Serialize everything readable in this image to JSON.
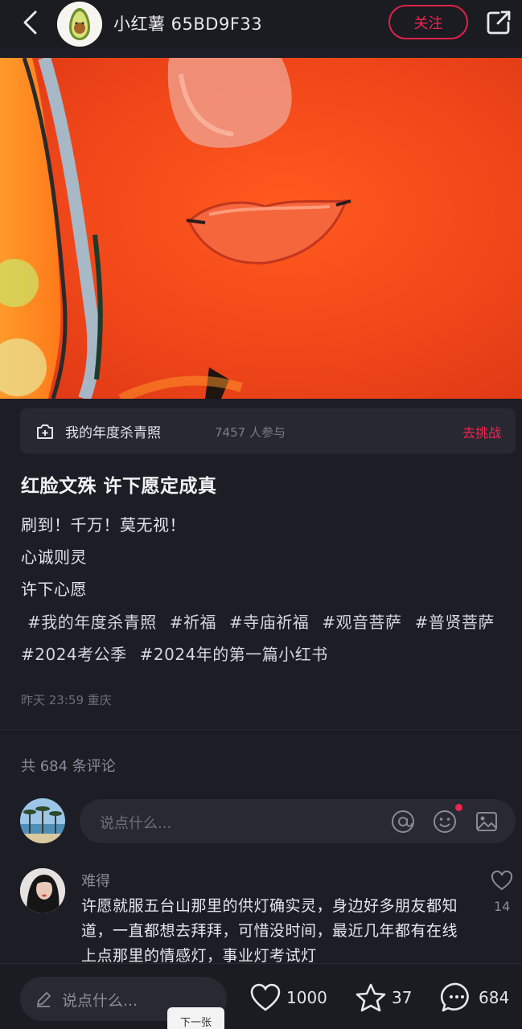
{
  "header": {
    "author_name": "小红薯 65BD9F33",
    "follow_label": "关注"
  },
  "activity": {
    "name": "我的年度杀青照",
    "participants": "7457 人参与",
    "cta": "去挑战"
  },
  "post": {
    "title": "红脸文殊 许下愿定成真",
    "lines": [
      "刷到！千万！莫无视！",
      "心诚则灵",
      "许下心愿"
    ],
    "tags": [
      "#我的年度杀青照",
      "#祈福",
      "#寺庙祈福",
      "#观音菩萨",
      "#普贤菩萨",
      "#2024考公季",
      "#2024年的第一篇小红书"
    ],
    "meta": "昨天 23:59 重庆"
  },
  "comments": {
    "count_label": "共 684 条评论",
    "input_placeholder": "说点什么...",
    "items": [
      {
        "user": "难得",
        "text": "许愿就服五台山那里的供灯确实灵，身边好多朋友都知道，一直都想去拜拜，可惜没时间，最近几年都有在线上点那里的情感灯，事业灯考试灯",
        "likes": "14"
      }
    ]
  },
  "bottom_bar": {
    "input_placeholder": "说点什么...",
    "likes": "1000",
    "collects": "37",
    "comments": "684"
  },
  "next_tip": "下一张",
  "colors": {
    "accent": "#f0244e",
    "background": "#1d1d26"
  },
  "icons": [
    "back-arrow-icon",
    "avocado-avatar",
    "share-icon",
    "activity-camera-icon",
    "at-icon",
    "emoji-icon",
    "image-icon",
    "heart-icon",
    "star-icon",
    "chat-bubble-icon",
    "pen-icon"
  ]
}
